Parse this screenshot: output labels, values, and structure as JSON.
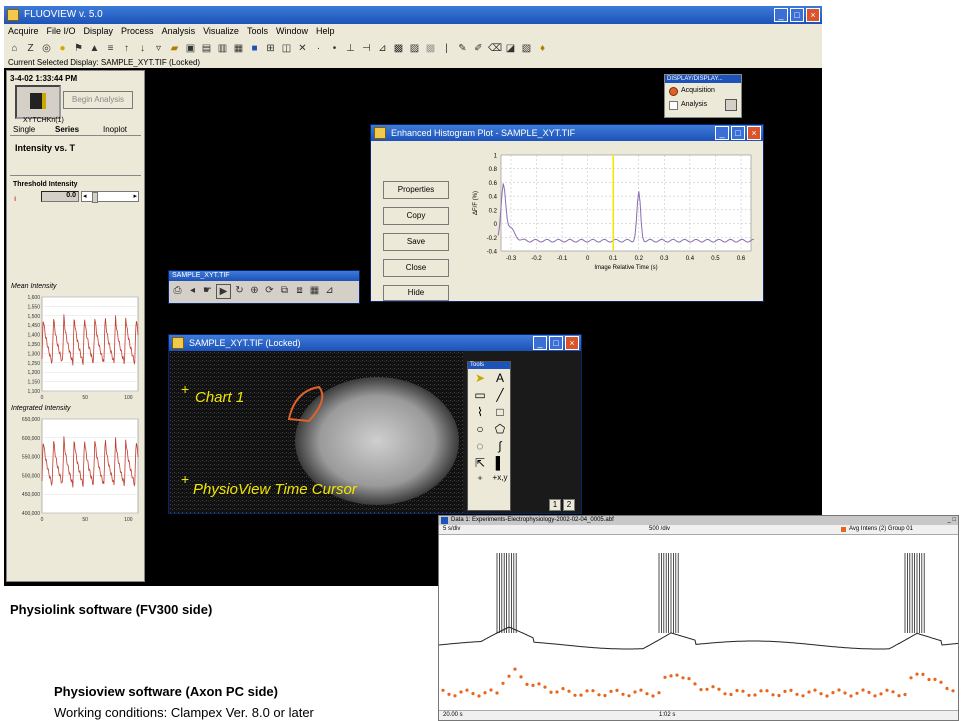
{
  "main_window": {
    "title": "FLUOVIEW v. 5.0",
    "menu": [
      "Acquire",
      "File I/O",
      "Display",
      "Process",
      "Analysis",
      "Visualize",
      "Tools",
      "Window",
      "Help"
    ],
    "status": "Current Selected Display: SAMPLE_XYT.TIF (Locked)"
  },
  "left_panel": {
    "timestamp": "3-4-02 1:33:44 PM",
    "begin_analysis_label": "Begin Analysis",
    "file_label": "XYTCHKn(1)",
    "tabs": [
      "Single",
      "Series",
      "Inoplot"
    ],
    "mode_title": "Intensity vs. T",
    "threshold_label": "Threshold Intensity",
    "threshold_value": "0.0",
    "mean_title": "Mean Intensity",
    "mean_yticks": [
      "1,600",
      "1,550",
      "1,500",
      "1,450",
      "1,400",
      "1,350",
      "1,300",
      "1,250",
      "1,200",
      "1,150",
      "1,100"
    ],
    "mean_xticks": [
      "0",
      "50",
      "100"
    ],
    "integrated_title": "Integrated Intensity",
    "integrated_yticks": [
      "650,000",
      "600,000",
      "550,000",
      "500,000",
      "450,000",
      "400,000"
    ],
    "integrated_xticks": [
      "0",
      "50",
      "100"
    ]
  },
  "mode_panel": {
    "title": "DISPLAY/DISPLAY...",
    "acquisition_label": "Acquisition",
    "analysis_label": "Analysis"
  },
  "histogram_window": {
    "title": "Enhanced Histogram Plot - SAMPLE_XYT.TIF",
    "buttons": [
      "Properties",
      "Copy",
      "Save",
      "Close",
      "Hide"
    ],
    "ylabel": "ΔF/F (%)",
    "xlabel": "Image Relative Time (s)",
    "yticks": [
      "1",
      "0.8",
      "0.6",
      "0.4",
      "0.2",
      "0",
      "-0.2",
      "-0.4"
    ],
    "xticks": [
      "-0.3",
      "-0.2",
      "-0.1",
      "0",
      "0.1",
      "0.2",
      "0.3",
      "0.4",
      "0.5",
      "0.6"
    ]
  },
  "small_toolbar": {
    "title": "SAMPLE_XYT.TIF"
  },
  "image_window": {
    "title": "SAMPLE_XYT.TIF (Locked)",
    "chart_label": "Chart 1",
    "cursor_label": "PhysioView Time Cursor",
    "tools_title": "Tools",
    "pages": [
      "1",
      "2"
    ]
  },
  "axon_window": {
    "title": "Data 1: Experiments-Electrophysiology-2002-02-04_0005.abf",
    "left_label": "5 s/div",
    "center_label": "500 /div",
    "legend_label": "Avg Intens (2) Group 01",
    "bottom_left": "20.00 s",
    "bottom_center": "1:02 s"
  },
  "captions": {
    "physiolink": "Physiolink software (FV300 side)",
    "physioview": "Physioview software (Axon PC side)",
    "conditions": "Working conditions: Clampex Ver. 8.0 or later"
  },
  "colors": {
    "title_blue": "#1d52b8",
    "trace_red": "#c0392b",
    "trace_purple": "#8a6fb0",
    "cursor_yellow": "#f2e600",
    "roi_orange": "#e0612a",
    "axon_orange": "#e8651c"
  }
}
